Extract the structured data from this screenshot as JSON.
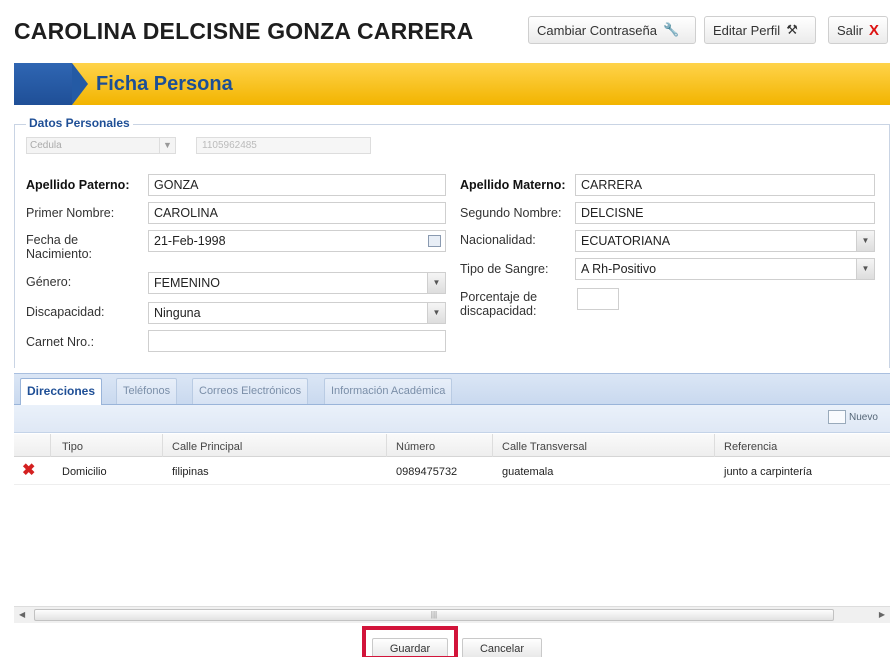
{
  "header": {
    "user_name": "CAROLINA DELCISNE GONZA CARRERA",
    "change_password": "Cambiar Contraseña",
    "edit_profile": "Editar Perfil",
    "exit": "Salir"
  },
  "banner": {
    "title": "Ficha Persona"
  },
  "personal": {
    "legend": "Datos Personales",
    "doc_type": "Cedula",
    "doc_number": "1105962485",
    "paternal_label": "Apellido Paterno:",
    "paternal_value": "GONZA",
    "maternal_label": "Apellido Materno:",
    "maternal_value": "CARRERA",
    "first_label": "Primer Nombre:",
    "first_value": "CAROLINA",
    "second_label": "Segundo Nombre:",
    "second_value": "DELCISNE",
    "birth_label": "Fecha de Nacimiento:",
    "birth_value": "21-Feb-1998",
    "nationality_label": "Nacionalidad:",
    "nationality_value": "ECUATORIANA",
    "gender_label": "Género:",
    "gender_value": "FEMENINO",
    "blood_label": "Tipo de Sangre:",
    "blood_value": "A Rh-Positivo",
    "disability_label": "Discapacidad:",
    "disability_value": "Ninguna",
    "disability_pct_label": "Porcentaje de discapacidad:",
    "disability_pct_value": "",
    "carnet_label": "Carnet Nro.:",
    "carnet_value": ""
  },
  "tabs": [
    "Direcciones",
    "Teléfonos",
    "Correos Electrónicos",
    "Información Académica"
  ],
  "toolbar": {
    "new": "Nuevo"
  },
  "grid": {
    "columns": [
      "Tipo",
      "Calle Principal",
      "Número",
      "Calle Transversal",
      "Referencia"
    ],
    "rows": [
      [
        "Domicilio",
        "filipinas",
        "0989475732",
        "guatemala",
        "junto a carpintería"
      ]
    ]
  },
  "actions": {
    "save": "Guardar",
    "cancel": "Cancelar"
  },
  "colors": {
    "accent_blue": "#1f4f96",
    "banner_yellow": "#f7c31c",
    "highlight": "#d2143a",
    "delete_red": "#d42020"
  },
  "icons": {
    "password": "key-pencil-icon",
    "edit": "wrench-icon",
    "exit": "close-x-icon",
    "row_delete": "delete-x-icon",
    "calendar": "calendar-icon",
    "new": "new-record-icon"
  }
}
